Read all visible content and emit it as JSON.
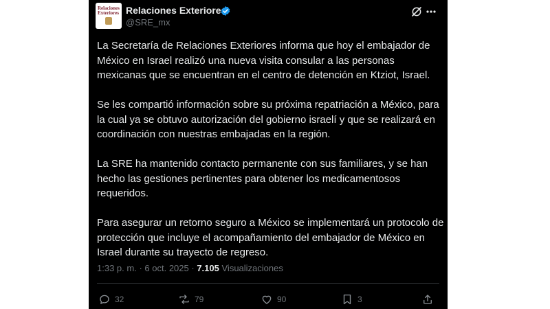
{
  "account": {
    "name": "Relaciones Exteriores",
    "handle": "@SRE_mx",
    "avatar_logo_lines": [
      "Relaciones",
      "Exteriores"
    ]
  },
  "tweet": {
    "paragraphs": [
      "La Secretaría de Relaciones Exteriores informa que hoy el embajador de México en Israel realizó una nueva visita consular a las personas mexicanas que se encuentran en el centro de detención en Ktziot, Israel.",
      "Se les compartió información sobre su próxima repatriación a México, para la cual ya se obtuvo autorización del gobierno israelí y que se realizará en coordinación con nuestras embajadas en la región.",
      "La SRE ha mantenido contacto permanente con sus familiares, y se han hecho las gestiones pertinentes para obtener los medicamentosos requeridos.",
      "Para asegurar un retorno seguro a México se implementará un protocolo de protección que incluye el acompañamiento del embajador de México en Israel durante su trayecto de regreso."
    ],
    "time": "1:33 p. m.",
    "separator": "·",
    "date": "6 oct. 2025",
    "views_count": "7.105",
    "views_label": "Visualizaciones"
  },
  "actions": {
    "replies": "32",
    "reposts": "79",
    "likes": "90",
    "bookmarks": "3"
  },
  "icons": [
    "verified-badge-icon",
    "grok-icon",
    "more-icon",
    "reply-icon",
    "repost-icon",
    "like-icon",
    "bookmark-icon",
    "share-icon"
  ],
  "colors": {
    "background": "#000000",
    "text": "#e7e9ea",
    "secondary": "#71767b",
    "verified": "#1d9bf0"
  }
}
